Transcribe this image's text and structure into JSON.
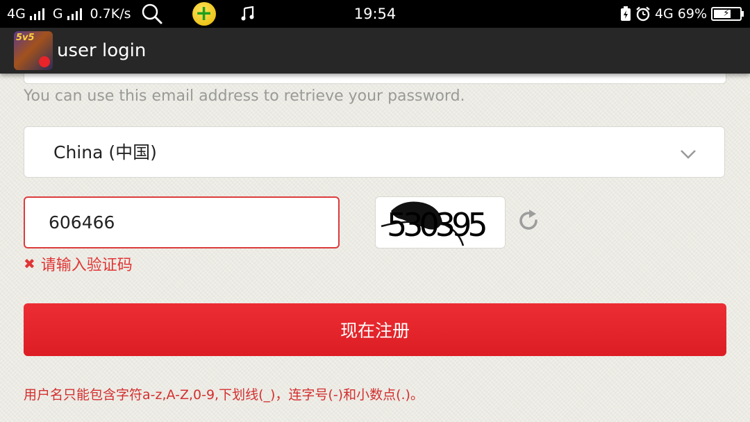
{
  "status_bar": {
    "network1": "4G",
    "network2": "G",
    "speed": "0.7K/s",
    "time": "19:54",
    "network_right": "4G",
    "battery_pct": "69%",
    "icons": [
      "search-icon",
      "360-app-icon",
      "music-note-icon",
      "battery-saver-icon",
      "alarm-icon",
      "battery-icon"
    ]
  },
  "titlebar": {
    "title": "user login",
    "icon_text": "5v5",
    "icon_name": "game-app-icon"
  },
  "form": {
    "email_hint": "You can use this email address to retrieve your password.",
    "country_value": "China (中国)",
    "captcha_value": "606466",
    "captcha_image_text": "530395",
    "error_text": "请输入验证码",
    "submit_label": "现在注册",
    "rules_text": "用户名只能包含字符a-z,A-Z,0-9,下划线(_)，连字号(-)和小数点(.)。"
  },
  "colors": {
    "accent_red": "#e8232a",
    "error_red": "#e03535",
    "titlebar_bg": "#272727",
    "statusbar_bg": "#000000",
    "page_bg": "#ecebe4"
  }
}
